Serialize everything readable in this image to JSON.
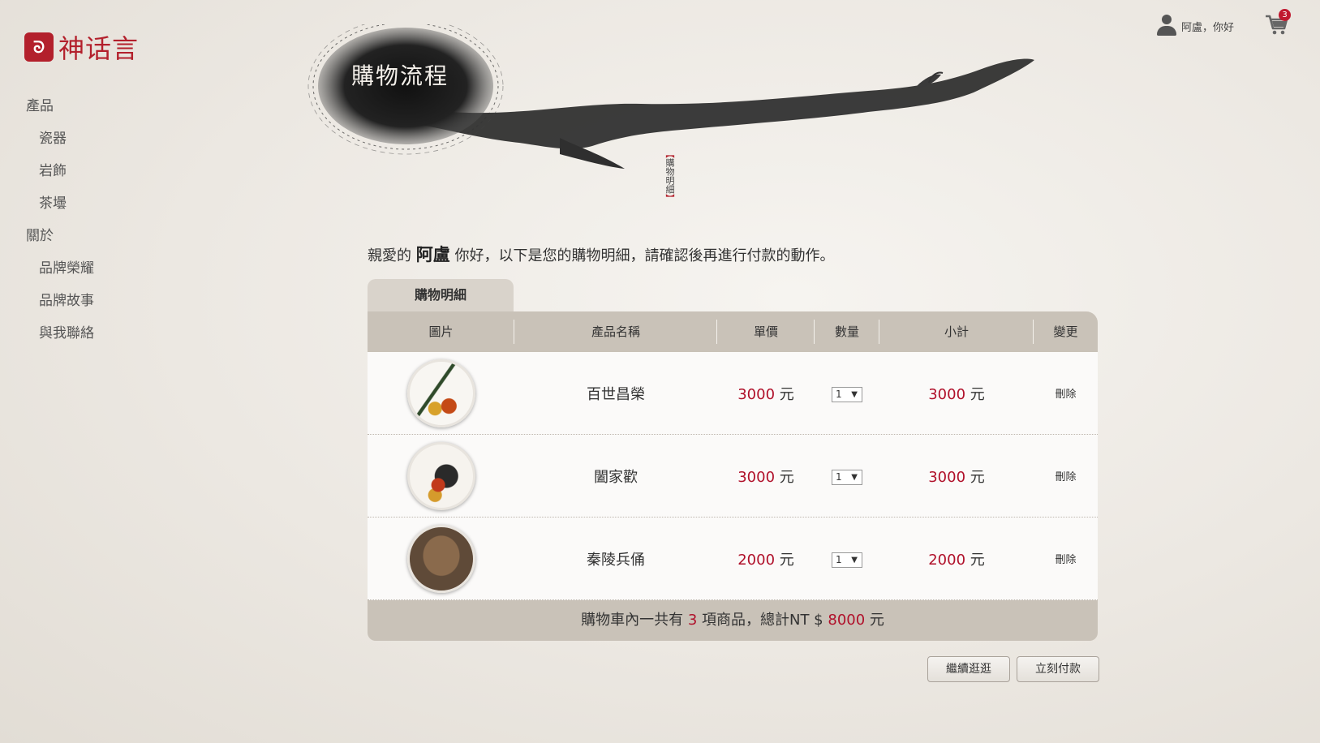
{
  "brand": {
    "mark": "ᘐ",
    "name": "神话言"
  },
  "nav": {
    "cat_products": "產品",
    "products": [
      "瓷器",
      "岩飾",
      "茶壜"
    ],
    "cat_about": "關於",
    "about": [
      "品牌榮耀",
      "品牌故事",
      "與我聯絡"
    ]
  },
  "user": {
    "greeting": "阿盧，你好",
    "cart_count": "3"
  },
  "banner": {
    "title": "購物流程",
    "tag": "購物明細"
  },
  "greeting": {
    "prefix": "親愛的",
    "name": "阿盧",
    "suffix": "你好，以下是您的購物明細，請確認後再進行付款的動作。"
  },
  "tab": "購物明細",
  "table": {
    "headers": [
      "圖片",
      "產品名稱",
      "單價",
      "數量",
      "小計",
      "變更"
    ],
    "rows": [
      {
        "name": "百世昌榮",
        "price": "3000",
        "qty": "1",
        "subtotal": "3000",
        "action": "刪除"
      },
      {
        "name": "闔家歡",
        "price": "3000",
        "qty": "1",
        "subtotal": "3000",
        "action": "刪除"
      },
      {
        "name": "秦陵兵俑",
        "price": "2000",
        "qty": "1",
        "subtotal": "2000",
        "action": "刪除"
      }
    ],
    "unit": "元",
    "footer": {
      "prefix": "購物車內一共有",
      "count": "3",
      "middle": "項商品，總計NT $",
      "total": "8000",
      "suffix": "元"
    }
  },
  "buttons": {
    "continue": "繼續逛逛",
    "pay": "立刻付款"
  },
  "colors": {
    "brand": "#b3202c",
    "price": "#b0102a",
    "header_bg": "#c9c2b8"
  }
}
